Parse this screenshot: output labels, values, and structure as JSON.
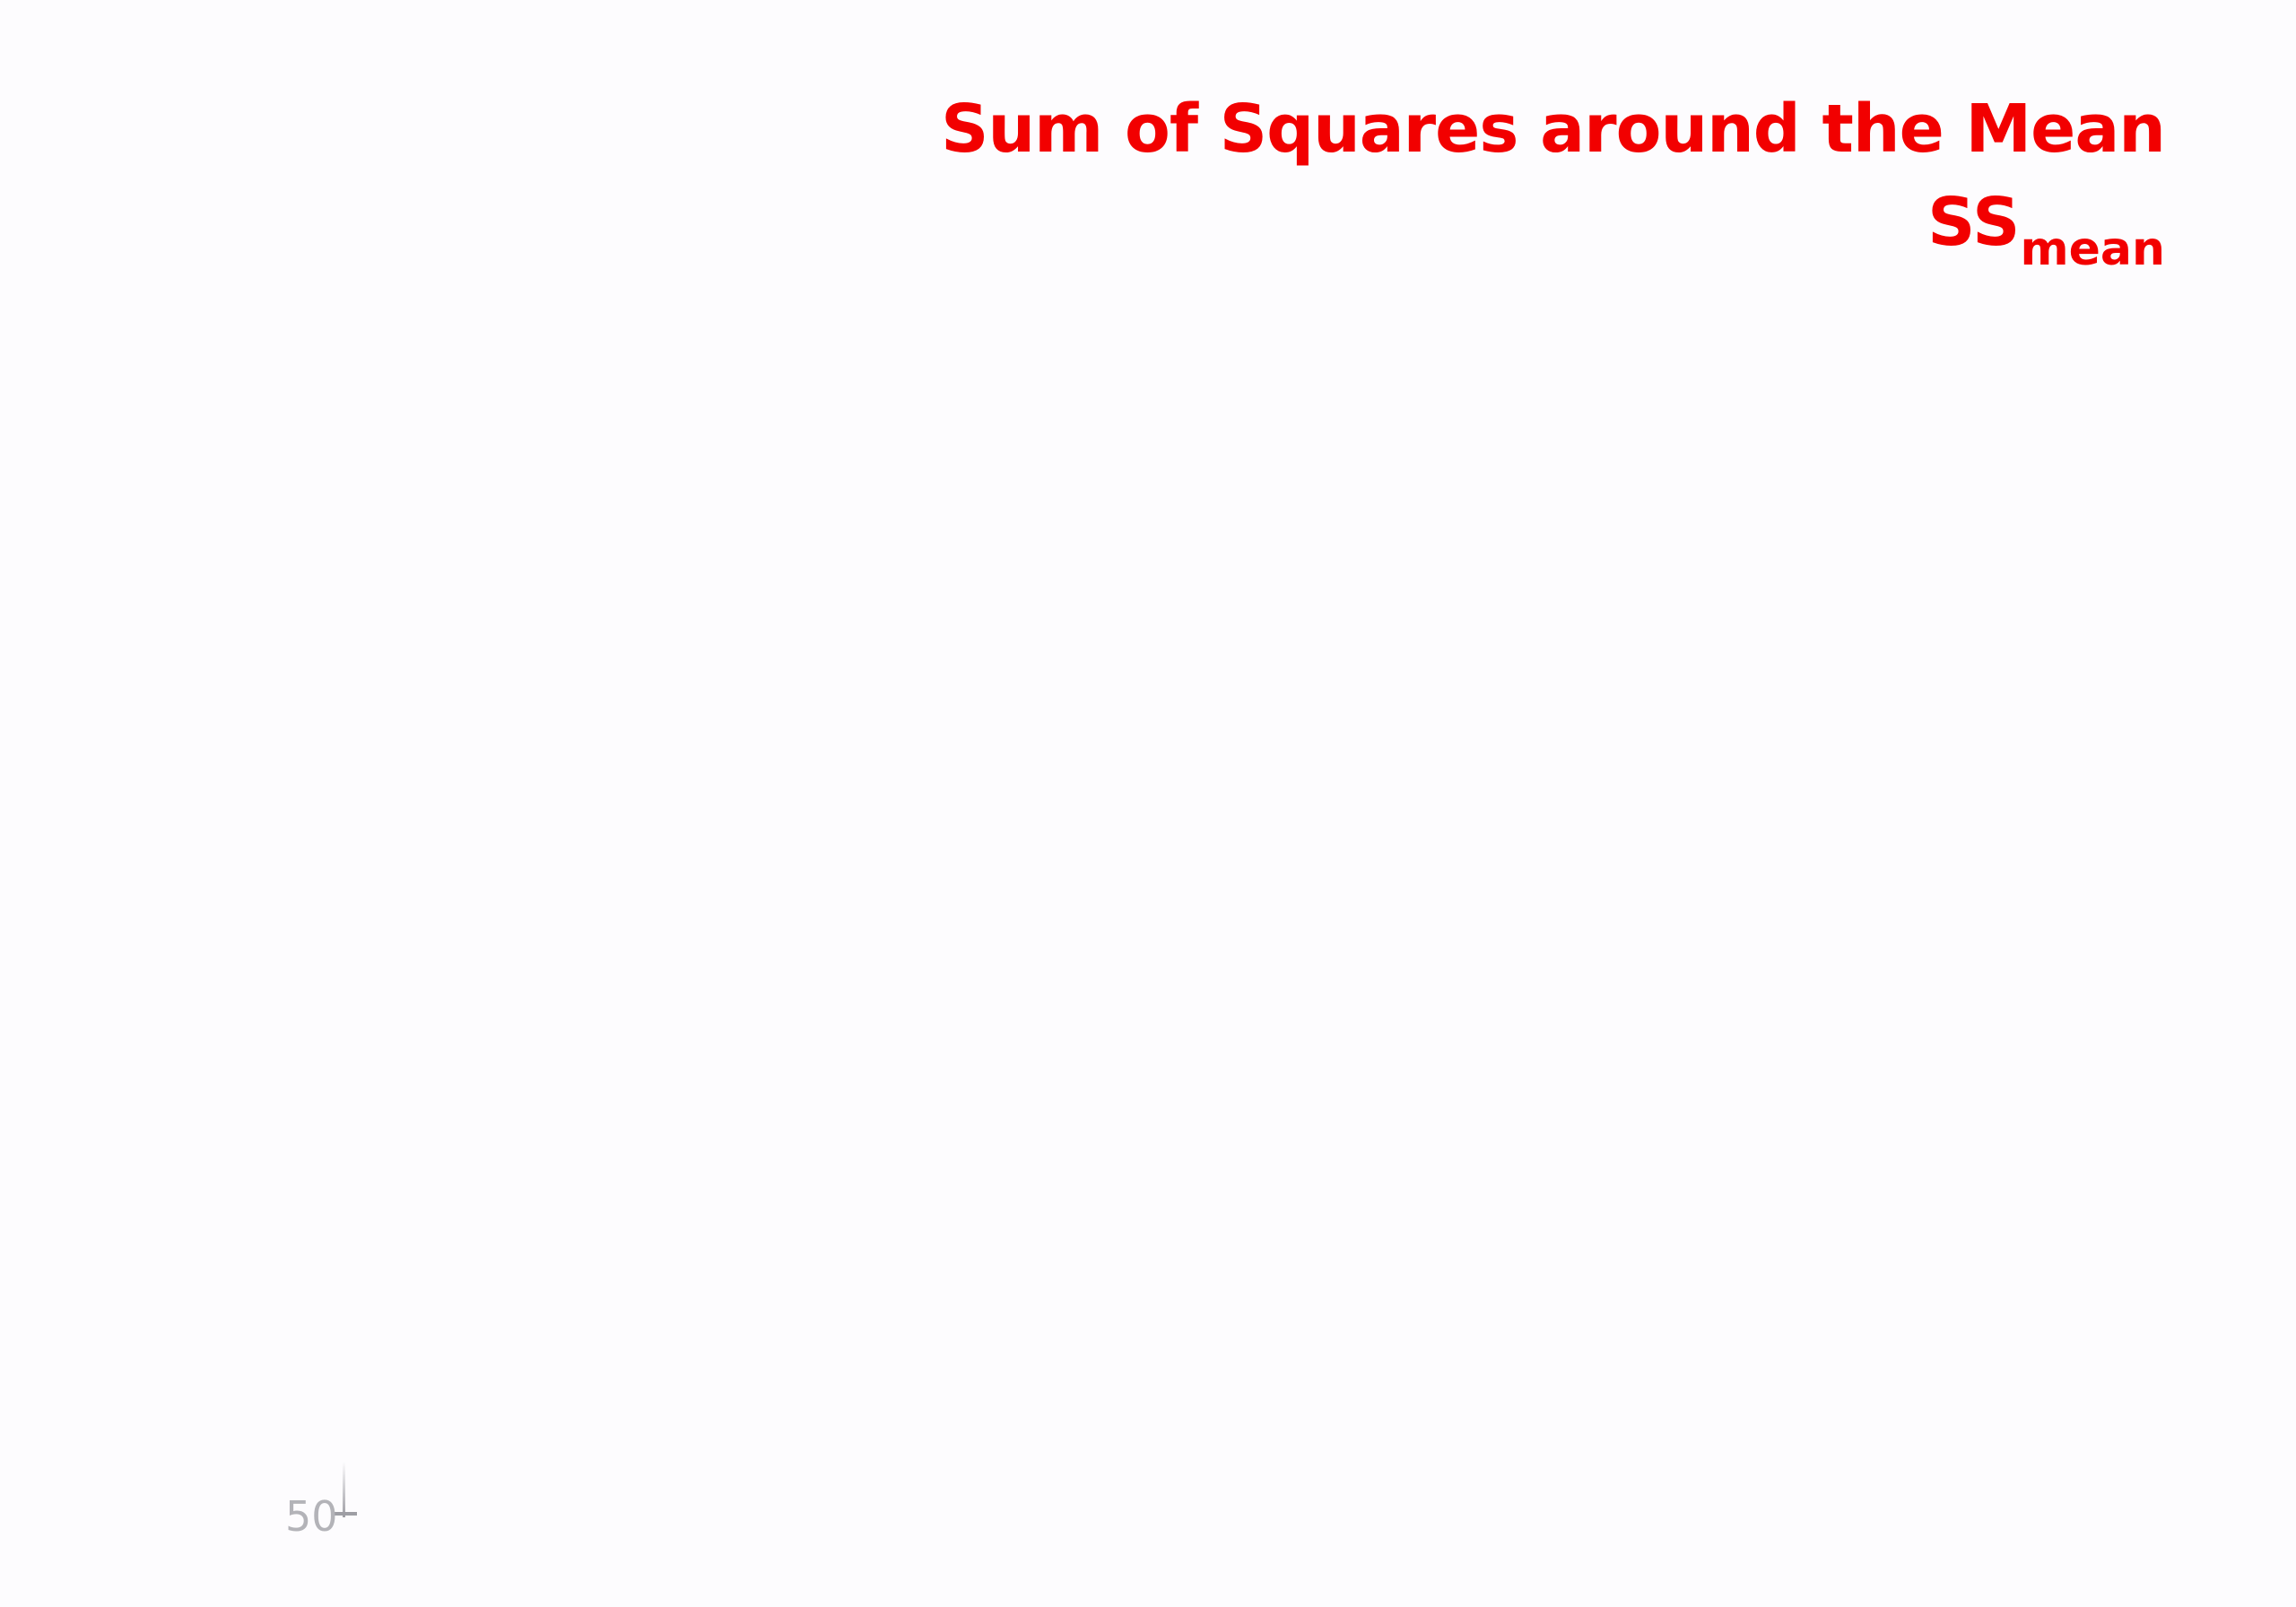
{
  "slide": {
    "title": "Sum of Squares around the Mean",
    "subtitle_main": "SS",
    "subtitle_sub": "mean",
    "title_color": "#f20000",
    "background_color": "#fdfcfe"
  },
  "axis": {
    "tick_label": "50"
  }
}
